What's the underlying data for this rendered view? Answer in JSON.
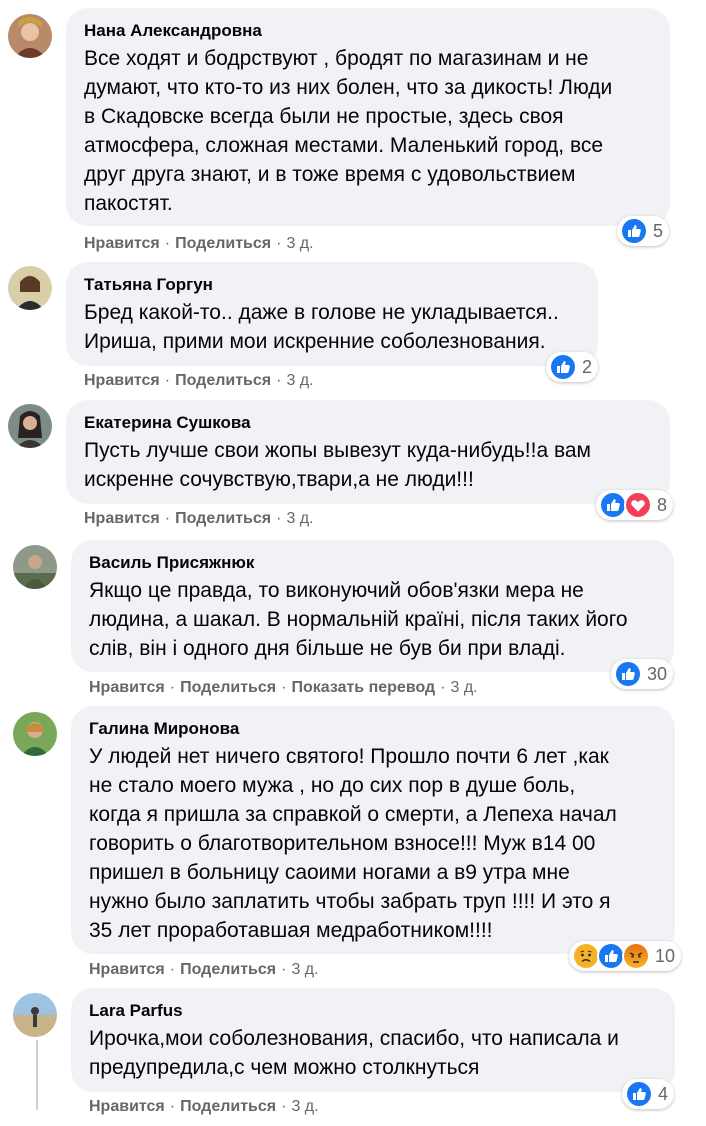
{
  "colors": {
    "bubble": "#f0f2f5",
    "like": "#1877f2",
    "love": "#f33e58",
    "sad_angry": "#f7b125",
    "meta_text": "#65676b"
  },
  "labels": {
    "like": "Нравится",
    "share": "Поделиться",
    "translate": "Показать перевод",
    "separator": "·"
  },
  "comments": [
    {
      "author": "Нана Александровна",
      "text": "Все ходят и бодрствуют , бродят по магазинам и не\nдумают, что кто-то из них болен, что за дикость! Люди\nв Скадовске всегда были не простые, здесь своя\nатмосфера, сложная местами. Маленький город, все\nдруг друга знают, и в тоже время с удовольствием\nпакостят.",
      "time": "3 д.",
      "reaction_count": "5",
      "reactions": [
        "like-icon"
      ]
    },
    {
      "author": "Татьяна Горгун",
      "text": "Бред какой-то.. даже в голове не укладывается..\nИриша, прими мои искренние соболезнования.",
      "time": "3 д.",
      "reaction_count": "2",
      "reactions": [
        "like-icon"
      ]
    },
    {
      "author": "Екатерина Сушкова",
      "text": "Пусть лучше свои жопы вывезут куда-нибудь!!а вам\nискренне сочувствую,твари,а не люди!!!",
      "time": "3 д.",
      "reaction_count": "8",
      "reactions": [
        "like-icon",
        "love-icon"
      ]
    },
    {
      "author": "Василь Присяжнюк",
      "text": "Якщо це правда, то виконуючий обов'язки мера не\nлюдина, а шакал. В нормальній країні, після таких його\nслів, він і одного дня більше не був би при владі.",
      "time": "3 д.",
      "reaction_count": "30",
      "reactions": [
        "like-icon"
      ]
    },
    {
      "author": "Галина Миронова",
      "text": "У людей нет ничего святого! Прошло почти 6 лет ,как\nне стало моего мужа , но до сих пор в душе боль,\nкогда я пришла за справкой о смерти, а Лепеха начал\nговорить о благотворительном взносе!!! Муж в14 00\nпришел в больницу саоими ногами а в9 утра мне\nнужно было заплатить чтобы забрать труп !!!! И это я\n35 лет проработавшая медработником!!!!",
      "time": "3 д.",
      "reaction_count": "10",
      "reactions": [
        "sad-icon",
        "like-icon",
        "angry-icon"
      ]
    },
    {
      "author": "Lara Parfus",
      "text": "Ирочка,мои соболезнования, спасибо, что написала и\nпредупредила,с чем можно столкнуться",
      "time": "3 д.",
      "reaction_count": "4",
      "reactions": [
        "like-icon"
      ]
    }
  ]
}
